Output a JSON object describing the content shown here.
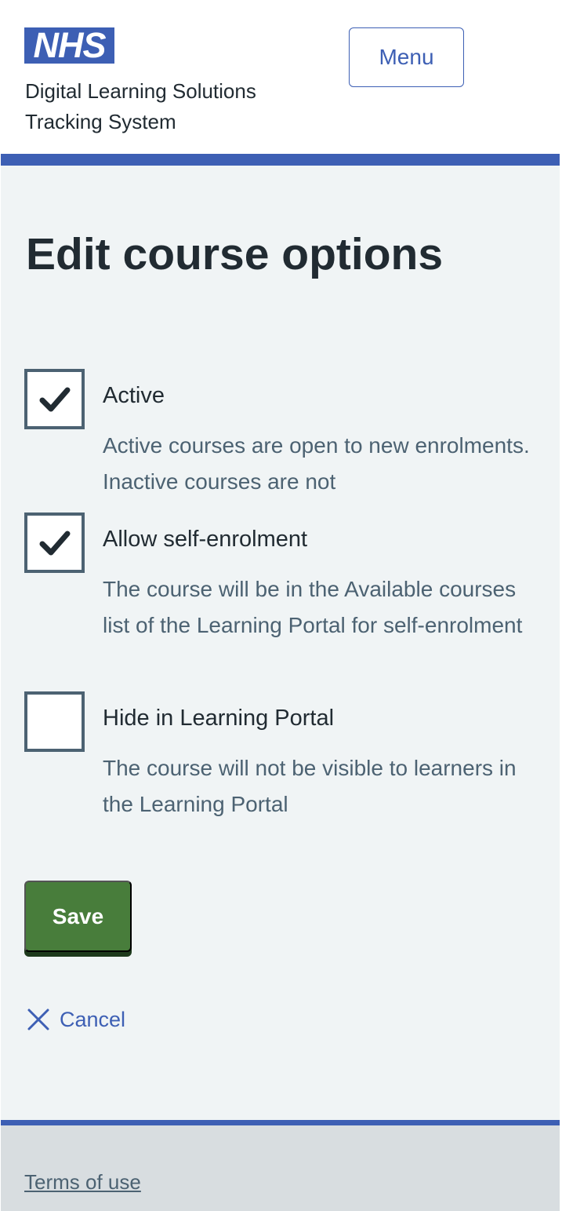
{
  "header": {
    "logo_text": "NHS",
    "service_name_line1": "Digital Learning Solutions",
    "service_name_line2": "Tracking System",
    "menu_label": "Menu"
  },
  "page": {
    "title": "Edit course options"
  },
  "options": [
    {
      "label": "Active",
      "checked": true,
      "hint": "Active courses are open to new enrolments. Inactive courses are not"
    },
    {
      "label": "Allow self-enrolment",
      "checked": true,
      "hint": "The course will be in the Available courses list of the Learning Portal for self-enrolment"
    },
    {
      "label": "Hide in Learning Portal",
      "checked": false,
      "hint": "The course will not be visible to learners in the Learning Portal"
    }
  ],
  "actions": {
    "save_label": "Save",
    "cancel_label": "Cancel"
  },
  "footer": {
    "terms_label": "Terms of use"
  },
  "colors": {
    "brand_blue": "#3d5fb4",
    "button_green": "#487d3b",
    "background": "#f0f4f5",
    "text": "#212b32",
    "hint_text": "#4c6272"
  }
}
